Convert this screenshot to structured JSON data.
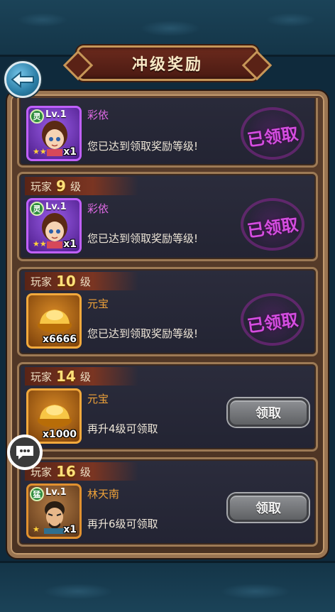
{
  "header": {
    "title": "冲级奖励"
  },
  "rewards": [
    {
      "level_prefix": "",
      "level": "",
      "level_suffix": "",
      "item_name": "彩依",
      "badge": "灵",
      "item_level": "Lv.1",
      "quantity": "x1",
      "desc": "您已达到领取奖励等级!",
      "status": "已领取"
    },
    {
      "level_prefix": "玩家",
      "level": "9",
      "level_suffix": "级",
      "item_name": "彩依",
      "badge": "灵",
      "item_level": "Lv.1",
      "quantity": "x1",
      "desc": "您已达到领取奖励等级!",
      "status": "已领取"
    },
    {
      "level_prefix": "玩家",
      "level": "10",
      "level_suffix": "级",
      "item_name": "元宝",
      "quantity": "x6666",
      "desc": "您已达到领取奖励等级!",
      "status": "已领取"
    },
    {
      "level_prefix": "玩家",
      "level": "14",
      "level_suffix": "级",
      "item_name": "元宝",
      "quantity": "x1000",
      "desc": "再升4级可领取",
      "button": "领取"
    },
    {
      "level_prefix": "玩家",
      "level": "16",
      "level_suffix": "级",
      "item_name": "林天南",
      "badge": "猛",
      "item_level": "Lv.1",
      "quantity": "x1",
      "desc": "再升6级可领取",
      "button": "领取"
    }
  ],
  "colors": {
    "accent_purple": "#c060ff",
    "accent_gold": "#f2a93c",
    "claimed_stamp": "#d44de0"
  }
}
